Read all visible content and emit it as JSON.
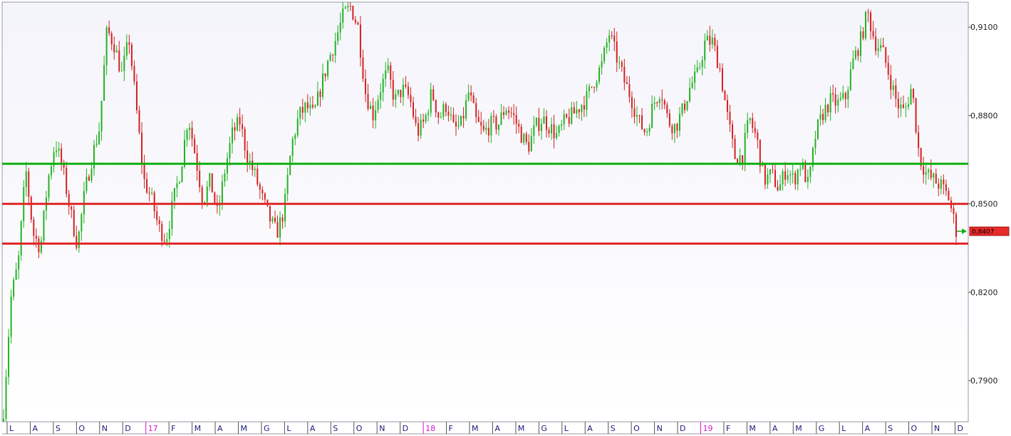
{
  "chart_data": {
    "type": "candlestick",
    "grid": false,
    "colors": {
      "up": "#22b222",
      "down": "#d42020",
      "support_green": "#10b010",
      "support_red": "#e02828",
      "plot_bg_top": "#f4f4fb",
      "plot_bg_bottom": "#ffffff"
    },
    "y_axis": {
      "range": [
        0.776,
        0.9185
      ],
      "ticks": [
        "0,9100",
        "0,8800",
        "0,8500",
        "0,8200",
        "0,7900"
      ],
      "tick_values": [
        0.91,
        0.88,
        0.85,
        0.82,
        0.79
      ]
    },
    "x_axis": {
      "month_labels": [
        "L",
        "A",
        "S",
        "O",
        "N",
        "D",
        "17",
        "F",
        "M",
        "A",
        "M",
        "G",
        "L",
        "A",
        "S",
        "O",
        "N",
        "D",
        "18",
        "F",
        "M",
        "A",
        "M",
        "G",
        "L",
        "A",
        "S",
        "O",
        "N",
        "D",
        "19",
        "F",
        "M",
        "A",
        "M",
        "G",
        "L",
        "A",
        "S",
        "O",
        "N",
        "D"
      ],
      "year_label_indices": [
        6,
        18,
        30
      ]
    },
    "horizontal_lines": [
      {
        "value": 0.8636,
        "color": "#10b010"
      },
      {
        "value": 0.85,
        "color": "#e02828"
      },
      {
        "value": 0.8365,
        "color": "#e02828"
      }
    ],
    "last_price": {
      "value": 0.8407,
      "label": "0,8407"
    },
    "series": [
      {
        "values": [
          0.78,
          0.818,
          0.83,
          0.862,
          0.84,
          0.835,
          0.858,
          0.871,
          0.862,
          0.848,
          0.836,
          0.854,
          0.866,
          0.876,
          0.909,
          0.904,
          0.894,
          0.906,
          0.882,
          0.858,
          0.852,
          0.842,
          0.838,
          0.851,
          0.862,
          0.88,
          0.866,
          0.851,
          0.858,
          0.846,
          0.862,
          0.874,
          0.878,
          0.866,
          0.86,
          0.852,
          0.845,
          0.84,
          0.848,
          0.87,
          0.88,
          0.883,
          0.88,
          0.89,
          0.899,
          0.906,
          0.914,
          0.917,
          0.91,
          0.888,
          0.88,
          0.889,
          0.895,
          0.885,
          0.889,
          0.886,
          0.874,
          0.878,
          0.888,
          0.879,
          0.884,
          0.875,
          0.877,
          0.888,
          0.878,
          0.874,
          0.877,
          0.877,
          0.883,
          0.88,
          0.874,
          0.869,
          0.876,
          0.879,
          0.876,
          0.873,
          0.878,
          0.88,
          0.883,
          0.886,
          0.892,
          0.897,
          0.908,
          0.9,
          0.892,
          0.886,
          0.878,
          0.874,
          0.884,
          0.889,
          0.878,
          0.876,
          0.882,
          0.89,
          0.894,
          0.905,
          0.905,
          0.896,
          0.88,
          0.866,
          0.866,
          0.879,
          0.872,
          0.858,
          0.86,
          0.855,
          0.862,
          0.858,
          0.864,
          0.856,
          0.874,
          0.881,
          0.885,
          0.884,
          0.886,
          0.898,
          0.905,
          0.915,
          0.905,
          0.902,
          0.893,
          0.884,
          0.881,
          0.89,
          0.866,
          0.86,
          0.858,
          0.856,
          0.852,
          0.841
        ]
      }
    ]
  }
}
